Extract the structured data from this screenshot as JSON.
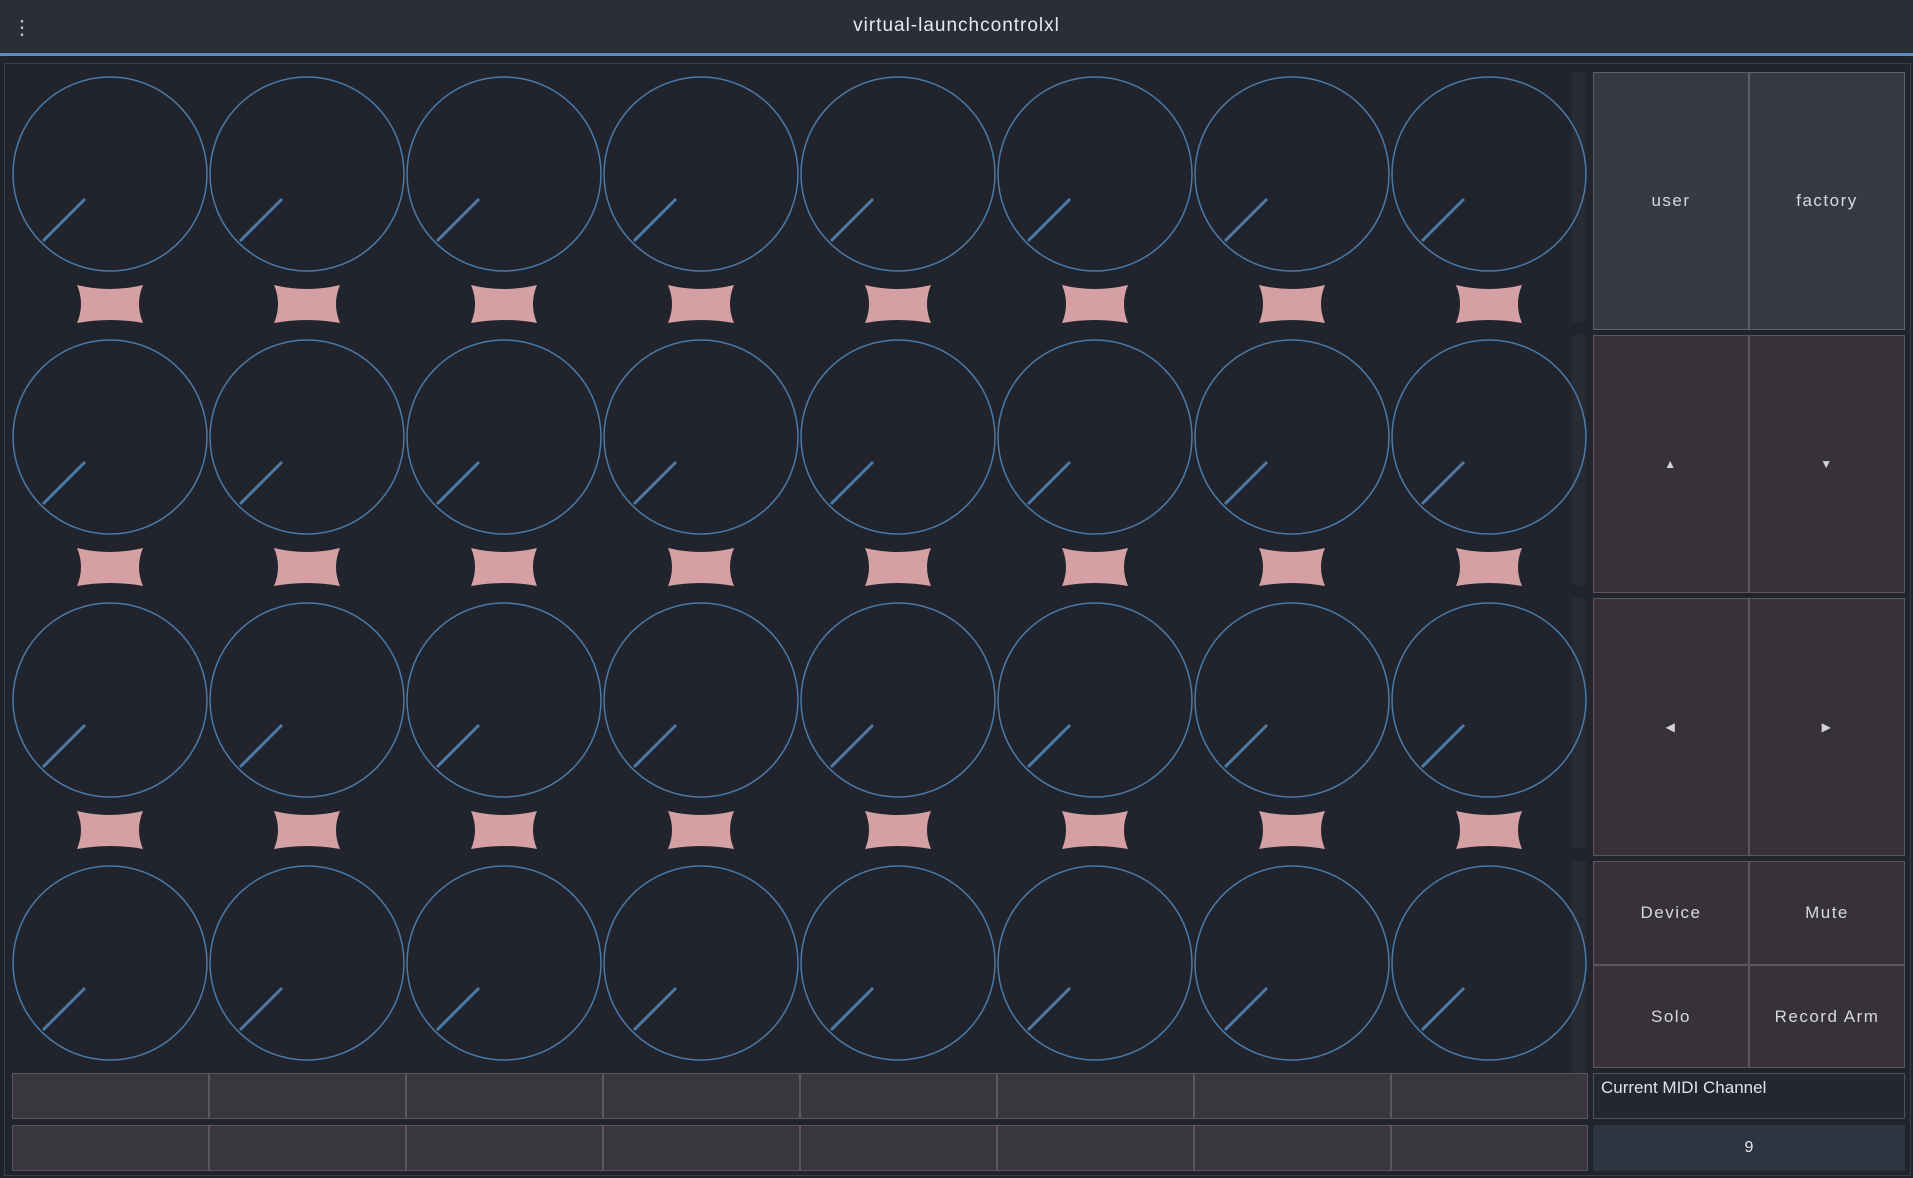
{
  "app": {
    "title": "virtual-launchcontrolxl"
  },
  "colors": {
    "accent": "#5b8ec7",
    "led": "#d4a0a3",
    "knob_ring": "#4c79a6"
  },
  "knobs": {
    "rows": 4,
    "columns": 8
  },
  "side_buttons": {
    "template_user": "user",
    "template_factory": "factory",
    "up_icon": "▲",
    "down_icon": "▼",
    "left_icon": "◀",
    "right_icon": "▶",
    "device": "Device",
    "mute": "Mute",
    "solo": "Solo",
    "record_arm": "Record Arm"
  },
  "midi": {
    "label": "Current MIDI Channel",
    "value": "9"
  }
}
